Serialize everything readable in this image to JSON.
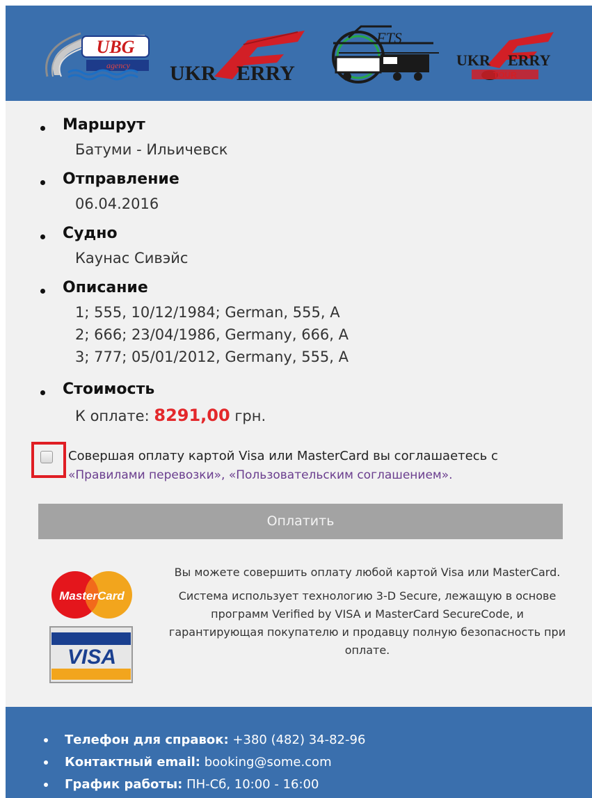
{
  "header": {
    "logos": [
      {
        "name": "ubg-agency-logo",
        "text": "UBG",
        "subtext": "agency"
      },
      {
        "name": "ukrferry-logo",
        "text": "UKRFERRY"
      },
      {
        "name": "fts-logo",
        "text": "FTS"
      },
      {
        "name": "ukrferry-tour-logo",
        "text": "UKRFERRY",
        "subtext": "TOUR"
      }
    ]
  },
  "details": {
    "route": {
      "title": "Маршрут",
      "value": "Батуми - Ильичевск"
    },
    "departure": {
      "title": "Отправление",
      "value": "06.04.2016"
    },
    "vessel": {
      "title": "Судно",
      "value": "Каунас Сивэйс"
    },
    "description": {
      "title": "Описание",
      "lines": [
        "1; 555, 10/12/1984; German, 555, A",
        "2; 666; 23/04/1986, Germany, 666, A",
        "3; 777; 05/01/2012, Germany, 555, A"
      ]
    },
    "cost": {
      "title": "Стоимость",
      "label": "К оплате:",
      "amount": "8291,00",
      "currency": "грн."
    }
  },
  "agreement": {
    "text": "Совершая оплату картой Visa или MasterCard вы соглашаетесь с",
    "link_rules": "«Правилами перевозки»",
    "separator": ",",
    "link_terms": "«Пользовательским соглашением»",
    "end": ".",
    "checked": false
  },
  "pay_button": {
    "label": "Оплатить",
    "color": "#a3a3a3"
  },
  "info": {
    "p1": "Вы можете совершить оплату любой картой Visa или MasterCard.",
    "p2": "Система использует технологию 3-D Secure, лежащую в основе программ Verified by VISA и MasterCard SecureCode, и гарантирующая покупателю и продавцу полную безопасность при оплате."
  },
  "cards": {
    "mastercard": "MasterCard",
    "visa": "VISA"
  },
  "footer": {
    "phone_label": "Телефон для справок:",
    "phone_value": "+380 (482) 34-82-96",
    "email_label": "Контактный email:",
    "email_value": "booking@some.com",
    "hours_label": "График работы:",
    "hours_value": "ПН-Сб, 10:00 - 16:00"
  },
  "colors": {
    "header": "#3a6fad",
    "price": "#e3282b",
    "highlight": "#e01e24",
    "link": "#6a3d8e"
  }
}
